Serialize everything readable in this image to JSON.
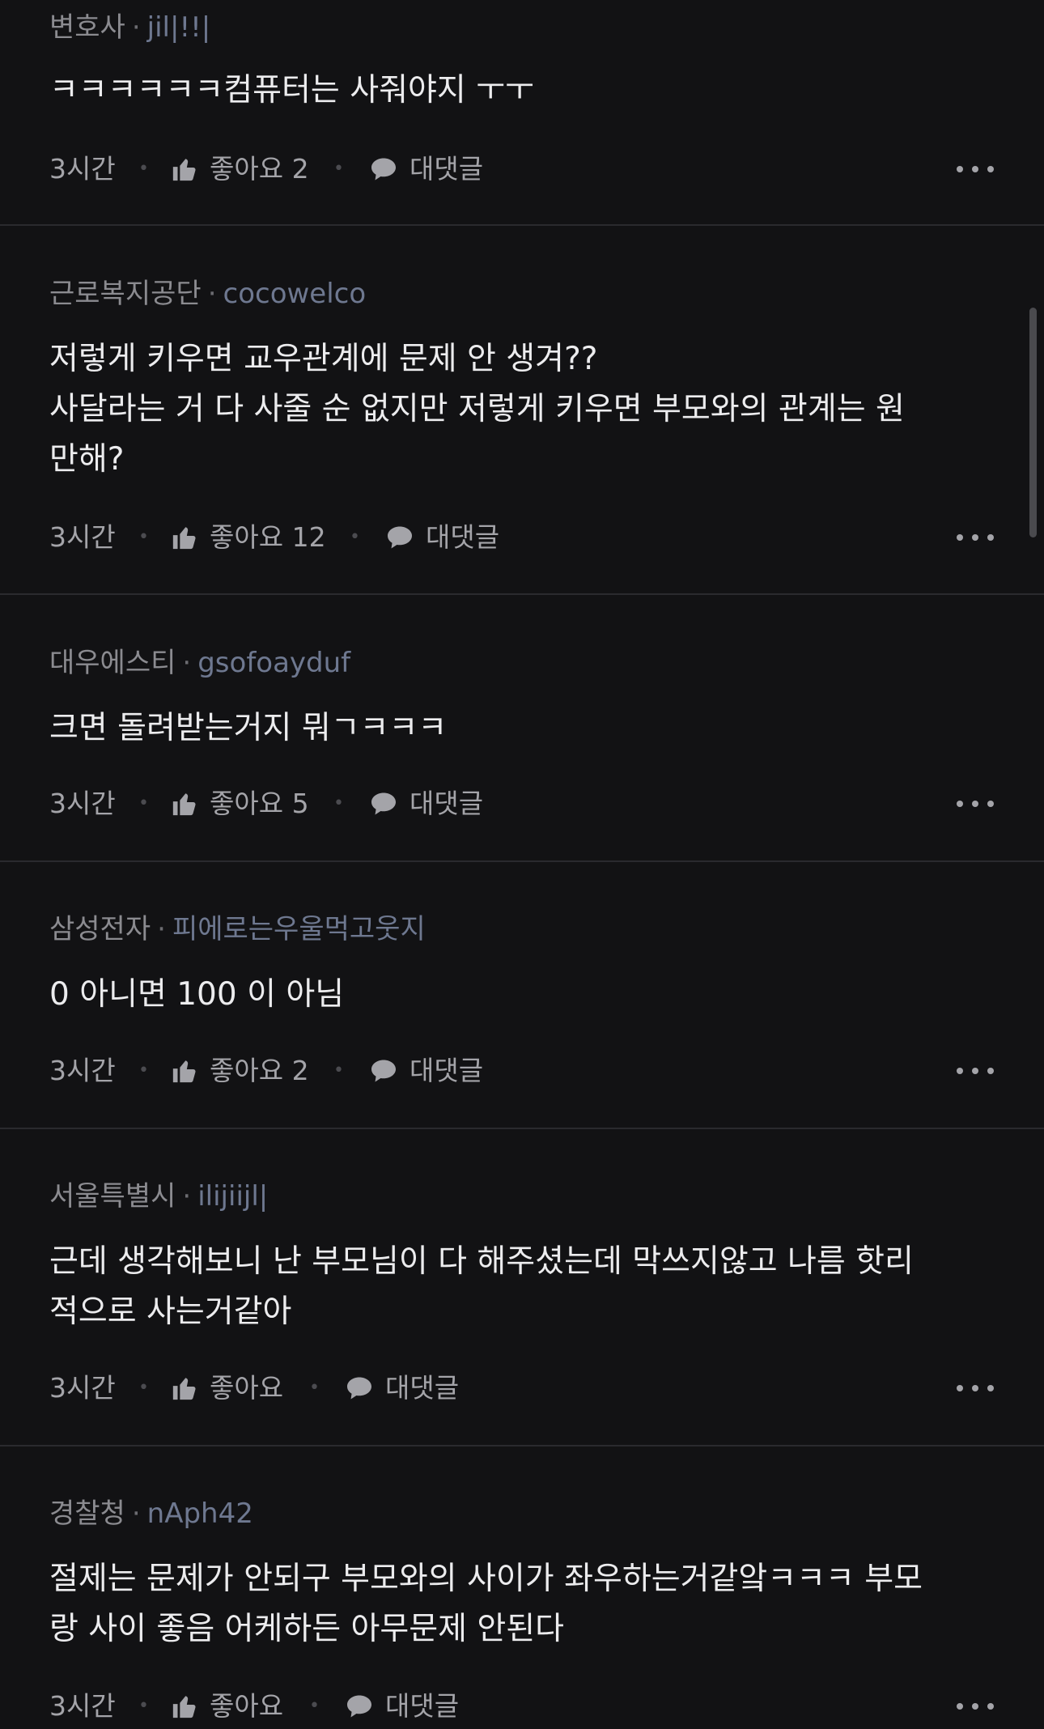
{
  "comments": [
    {
      "company": "변호사",
      "nickname": "jil|!!|",
      "text": "ㅋㅋㅋㅋㅋㅋ컴퓨터는 사줘야지 ㅜㅜ",
      "time": "3시간",
      "like_label": "좋아요 2",
      "reply_label": "대댓글"
    },
    {
      "company": "근로복지공단",
      "nickname": "cocowelco",
      "text": "저렇게 키우면 교우관계에 문제 안 생겨??\n사달라는 거 다 사줄 순 없지만 저렇게 키우면 부모와의 관계는 원\n만해?",
      "time": "3시간",
      "like_label": "좋아요 12",
      "reply_label": "대댓글"
    },
    {
      "company": "대우에스티",
      "nickname": "gsofoayduf",
      "text": "크면 돌려받는거지 뭐ㄱㅋㅋㅋ",
      "time": "3시간",
      "like_label": "좋아요 5",
      "reply_label": "대댓글"
    },
    {
      "company": "삼성전자",
      "nickname": "피에로는우울먹고웃지",
      "text": "0 아니면 100 이 아님",
      "time": "3시간",
      "like_label": "좋아요 2",
      "reply_label": "대댓글"
    },
    {
      "company": "서울특별시",
      "nickname": "ilijiijl|",
      "text": "근데 생각해보니 난 부모님이 다 해주셨는데 막쓰지않고 나름 핫리\n적으로 사는거같아",
      "time": "3시간",
      "like_label": "좋아요",
      "reply_label": "대댓글"
    },
    {
      "company": "경찰청",
      "nickname": "nAph42",
      "text": "절제는 문제가 안되구 부모와의 사이가 좌우하는거같앜ㅋㅋㅋ 부모\n랑 사이 좋음 어케하든 아무문제 안된다",
      "time": "3시간",
      "like_label": "좋아요",
      "reply_label": "대댓글"
    }
  ],
  "colors": {
    "background": "#121214",
    "divider": "#2a2a2e",
    "company_text": "#8b8b90",
    "nickname_text": "#6e7890",
    "meta_text": "#a4a4a9"
  },
  "icons": {
    "like": "thumbs-up-icon",
    "reply": "speech-bubble-icon",
    "more": "more-dots-icon"
  }
}
